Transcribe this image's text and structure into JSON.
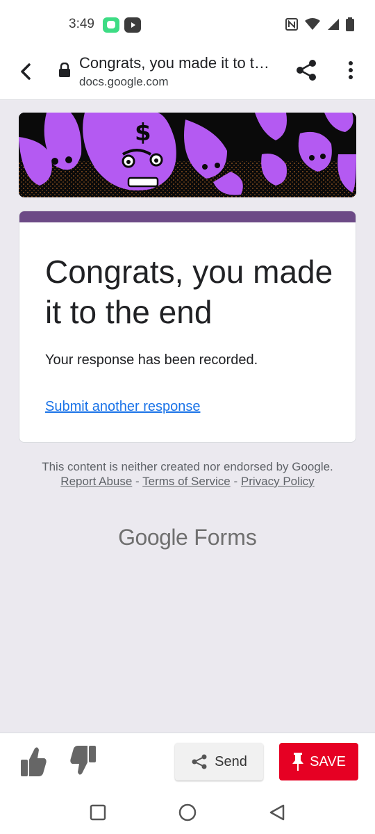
{
  "status_bar": {
    "time": "3:49",
    "app_icons": [
      "chat-app-icon",
      "youtube-icon"
    ],
    "system_icons": [
      "nfc-icon",
      "wifi-icon",
      "signal-icon",
      "battery-icon"
    ]
  },
  "toolbar": {
    "title": "Congrats, you made it to the end",
    "host": "docs.google.com",
    "icons": [
      "back-arrow-icon",
      "lock-icon",
      "share-icon",
      "more-vert-icon"
    ]
  },
  "banner": {
    "description_icon": "purple-money-characters-illustration",
    "colors": {
      "primary": "#b45af2",
      "background": "#0a0a0a",
      "speckle": "#d1782a"
    }
  },
  "form_card": {
    "accent_color": "#6c4a86",
    "title": "Congrats, you made it to the end",
    "message": "Your response has been recorded.",
    "link": "Submit another response"
  },
  "footer": {
    "disclaimer": "This content is neither created nor endorsed by Google.",
    "report_abuse": "Report Abuse",
    "separator": "-",
    "terms": "Terms of Service",
    "privacy": "Privacy Policy",
    "brand_google": "Google",
    "brand_forms": "Forms"
  },
  "action_bar": {
    "thumb_up_icon": "thumbs-up-icon",
    "thumb_down_icon": "thumbs-down-icon",
    "send_label": "Send",
    "save_label": "SAVE",
    "save_color": "#e60023"
  },
  "nav_bar": {
    "icons": [
      "recents-square-icon",
      "home-circle-icon",
      "back-triangle-icon"
    ]
  }
}
